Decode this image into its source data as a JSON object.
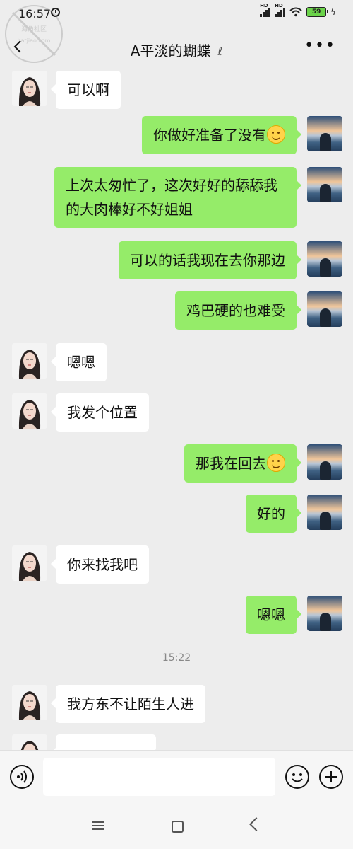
{
  "status_bar": {
    "time": "16:57",
    "sig1_label": "HD",
    "sig2_label": "HD",
    "battery": "59"
  },
  "watermark": {
    "text": "海角社区",
    "url": "hatjiao.com"
  },
  "header": {
    "title": "A平淡的蝴蝶"
  },
  "messages": [
    {
      "side": "left",
      "text": "可以啊"
    },
    {
      "side": "right",
      "text": "你做好准备了没有",
      "emoji": "smile-emoji"
    },
    {
      "side": "right",
      "text": "上次太匆忙了，这次好好的舔舔我的大肉棒好不好姐姐"
    },
    {
      "side": "right",
      "text": "可以的话我现在去你那边"
    },
    {
      "side": "right",
      "text": "鸡巴硬的也难受"
    },
    {
      "side": "left",
      "text": "嗯嗯"
    },
    {
      "side": "left",
      "text": "我发个位置"
    },
    {
      "side": "right",
      "text": "那我在回去",
      "emoji": "smile-emoji"
    },
    {
      "side": "right",
      "text": "好的"
    },
    {
      "side": "left",
      "text": "你来找我吧"
    },
    {
      "side": "right",
      "text": "嗯嗯"
    },
    {
      "side": "left",
      "text": "我方东不让陌生人进"
    },
    {
      "side": "left",
      "text": ""
    }
  ],
  "timestamp": "15:22",
  "input": {
    "value": ""
  },
  "colors": {
    "accent_bubble": "#95ec69",
    "background": "#ededed"
  }
}
